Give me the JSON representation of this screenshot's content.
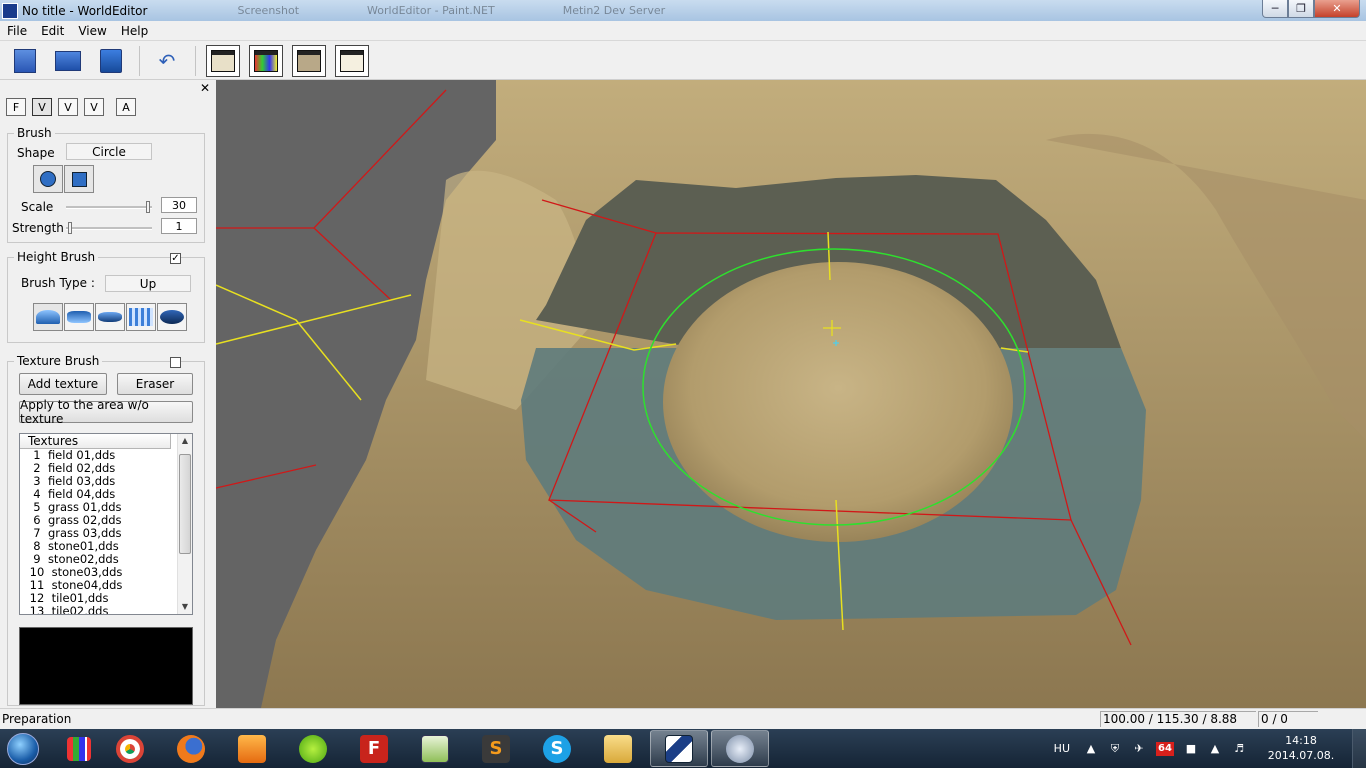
{
  "window": {
    "title": "No title - WorldEditor",
    "ghost_tabs": [
      "Screenshot",
      "WorldEditor - Paint.NET",
      "Metin2 Dev Server"
    ]
  },
  "menu": [
    "File",
    "Edit",
    "View",
    "Help"
  ],
  "toolbar": {
    "buttons": [
      "new-file",
      "open-folder",
      "save",
      "undo",
      "map-view",
      "texture-view",
      "object-view",
      "edit-view"
    ]
  },
  "panel": {
    "tabs": [
      "F",
      "V",
      "V",
      "V",
      "A"
    ],
    "brush": {
      "legend": "Brush",
      "shape_label": "Shape",
      "shape_value": "Circle",
      "scale_label": "Scale",
      "scale_value": "30",
      "strength_label": "Strength",
      "strength_value": "1"
    },
    "height_brush": {
      "legend": "Height Brush",
      "checked": true,
      "type_label": "Brush Type :",
      "type_value": "Up"
    },
    "texture_brush": {
      "legend": "Texture Brush",
      "checked": false,
      "add_label": "Add texture",
      "eraser_label": "Eraser",
      "apply_label": "Apply to the area w/o texture",
      "list_header": "Textures",
      "items": [
        "  1  field 01,dds",
        "  2  field 02,dds",
        "  3  field 03,dds",
        "  4  field 04,dds",
        "  5  grass 01,dds",
        "  6  grass 02,dds",
        "  7  grass 03,dds",
        "  8  stone01,dds",
        "  9  stone02,dds",
        " 10  stone03,dds",
        " 11  stone04,dds",
        " 12  tile01,dds",
        " 13  tile02,dds"
      ]
    }
  },
  "status": {
    "left": "Preparation",
    "coords": "100.00 / 115.30 / 8.88",
    "count": "0 / 0"
  },
  "taskbar": {
    "lang": "HU",
    "battery": "64",
    "time": "14:18",
    "date": "2014.07.08."
  },
  "colors": {
    "terrain": "#b9a476",
    "water": "#5e7b7c",
    "viewport_bg": "#646464",
    "brush_circle": "#2ee02e",
    "grid_red": "#d01818",
    "grid_yellow": "#e8e020"
  }
}
